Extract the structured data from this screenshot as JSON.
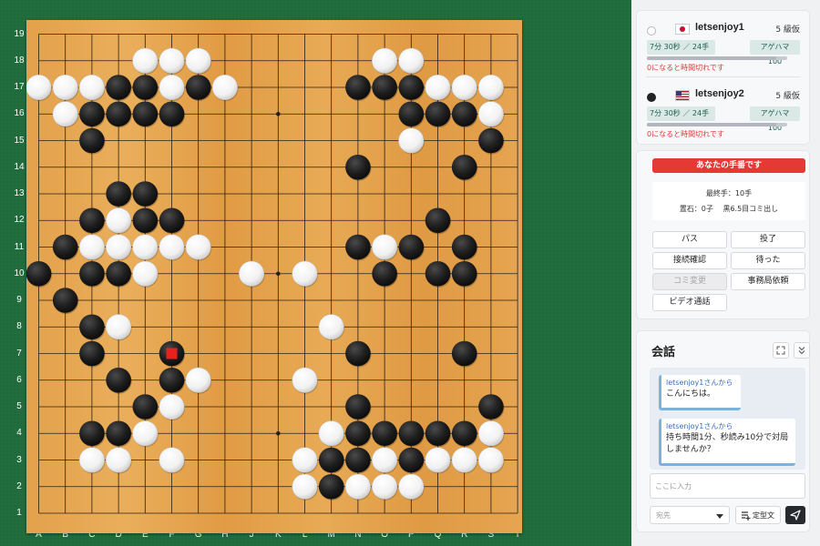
{
  "board": {
    "size": 19,
    "col_labels": [
      "A",
      "B",
      "C",
      "D",
      "E",
      "F",
      "G",
      "H",
      "J",
      "K",
      "L",
      "M",
      "N",
      "O",
      "P",
      "Q",
      "R",
      "S",
      "T"
    ],
    "row_labels": [
      "19",
      "18",
      "17",
      "16",
      "15",
      "14",
      "13",
      "12",
      "11",
      "10",
      "9",
      "8",
      "7",
      "6",
      "5",
      "4",
      "3",
      "2",
      "1"
    ],
    "star_points": [
      "D16",
      "K16",
      "Q16",
      "D10",
      "K10",
      "Q10",
      "D4",
      "K4",
      "Q4"
    ],
    "last_move": "F7",
    "last_move_marker_color": "#e8201e",
    "black_stones": [
      "D17",
      "E17",
      "G17",
      "C16",
      "D16",
      "E16",
      "F16",
      "C15",
      "D13",
      "E13",
      "C12",
      "E12",
      "F12",
      "B11",
      "A10",
      "C10",
      "D10",
      "B9",
      "C8",
      "C7",
      "F7",
      "D6",
      "F6",
      "E5",
      "C4",
      "D4",
      "N17",
      "O17",
      "P17",
      "P16",
      "Q16",
      "R16",
      "S15",
      "N14",
      "R14",
      "Q12",
      "N11",
      "P11",
      "R11",
      "O10",
      "Q10",
      "R10",
      "N7",
      "R7",
      "N5",
      "S5",
      "N4",
      "O4",
      "P4",
      "Q4",
      "R4",
      "M3",
      "N3",
      "P3",
      "M2"
    ],
    "white_stones": [
      "E18",
      "F18",
      "G18",
      "A17",
      "B17",
      "C17",
      "F17",
      "H17",
      "B16",
      "D12",
      "C11",
      "D11",
      "E11",
      "F11",
      "G11",
      "E10",
      "J10",
      "L10",
      "D8",
      "G6",
      "F5",
      "E4",
      "C3",
      "D3",
      "F3",
      "O18",
      "P18",
      "Q17",
      "R17",
      "S17",
      "S16",
      "P15",
      "O11",
      "M8",
      "L6",
      "M4",
      "S4",
      "L3",
      "O3",
      "Q3",
      "R3",
      "S3",
      "L2",
      "N2",
      "O2",
      "P2"
    ]
  },
  "players": [
    {
      "name": "letsenjoy1",
      "stone": "white",
      "flag": "jp-flag",
      "rank": "5 級仮",
      "time": "7分 30秒 ／ 24手",
      "captures": "アゲハマ　100",
      "time_fraction": 0.92,
      "warning": "0になると時間切れです"
    },
    {
      "name": "letsenjoy2",
      "stone": "black",
      "flag": "us-flag",
      "rank": "5 級仮",
      "time": "7分 30秒 ／ 24手",
      "captures": "アゲハマ　100",
      "time_fraction": 0.92,
      "warning": "0になると時間切れです"
    }
  ],
  "status": {
    "turn_banner": "あなたの手番です",
    "last_move": "最終手：10手",
    "handicap": "置石：0子　 黒6.5目コミ出し"
  },
  "actions": {
    "pass": "パス",
    "resign": "投了",
    "check_connection": "接続確認",
    "undo": "待った",
    "change_komi": "コミ変更",
    "request_office": "事務局依頼",
    "video_call": "ビデオ通話"
  },
  "chat": {
    "title": "会話",
    "messages": [
      {
        "sender": "letsenjoy1さんから",
        "text": "こんにちは。"
      },
      {
        "sender": "letsenjoy1さんから",
        "text": "持ち時間1分、秒読み10分で対局しませんか？"
      }
    ],
    "input_placeholder": "ここに入力",
    "recipient_placeholder": "宛先",
    "template_button": "定型文"
  },
  "colors": {
    "table_green": "#1f6b3c",
    "board_wood": "#e3a14c",
    "turn_banner": "#e53935",
    "time_chip": "#dbe9e6",
    "warning_text": "#e03a3a",
    "chat_sender": "#3a6ebd",
    "send_button": "#26292e"
  }
}
